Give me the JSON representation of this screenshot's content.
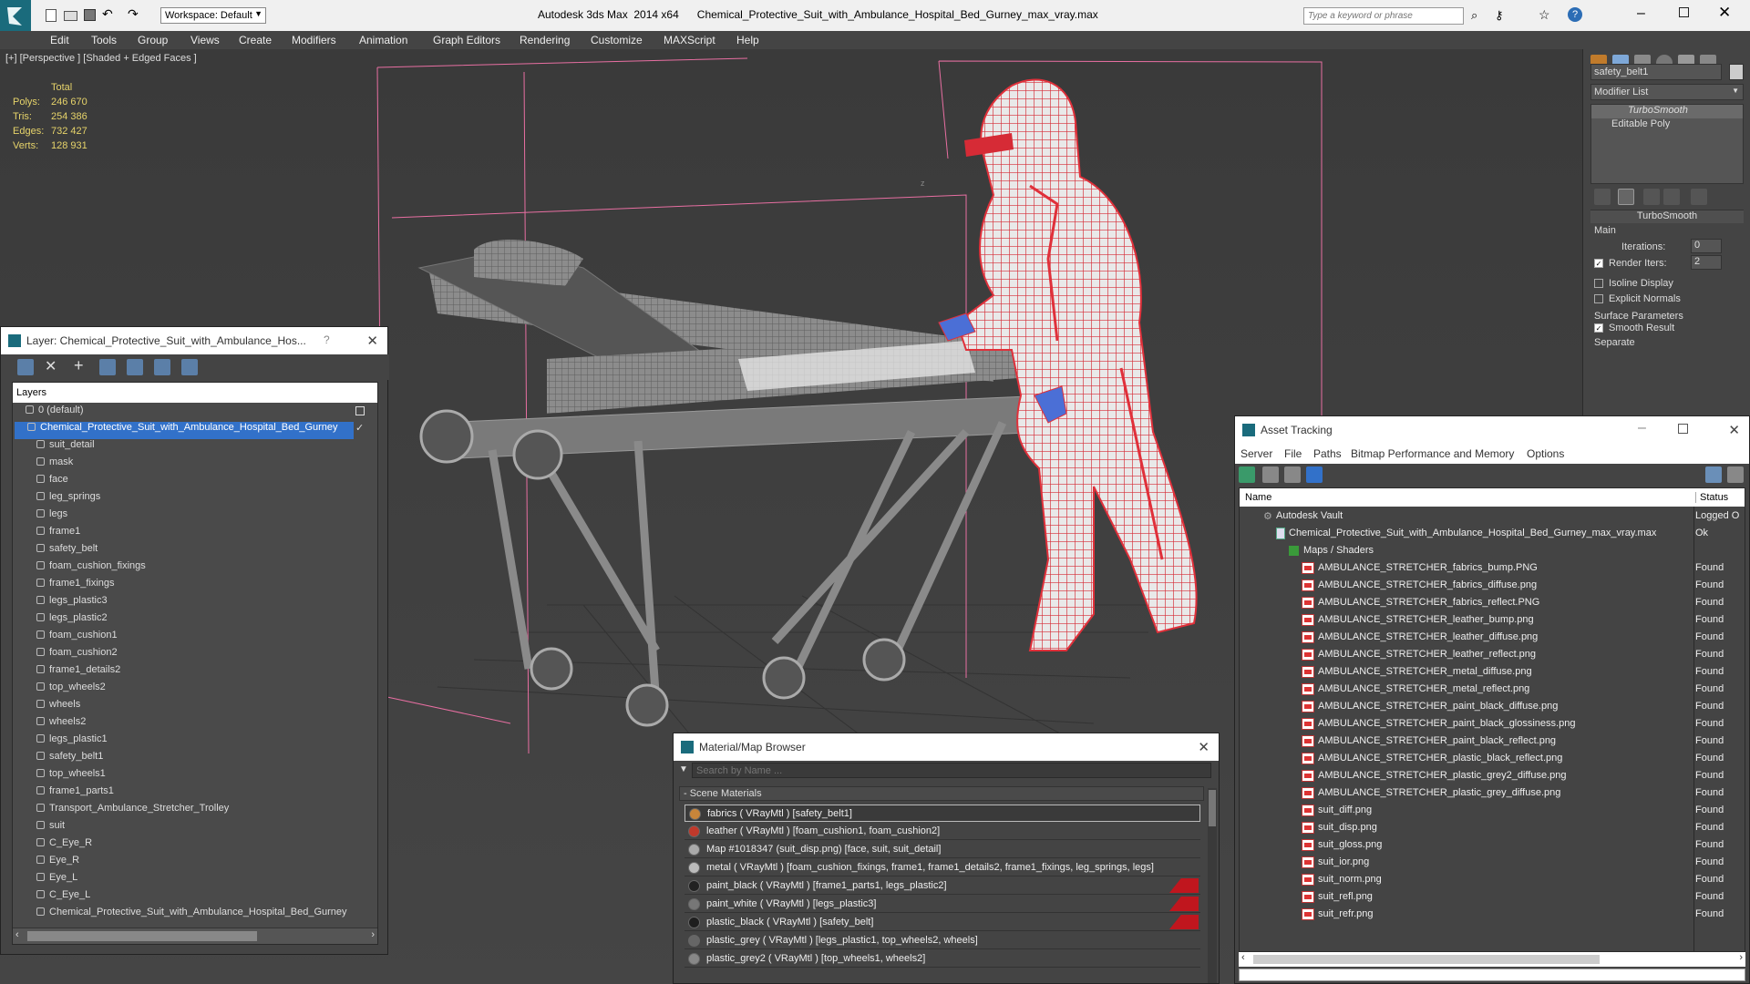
{
  "titlebar": {
    "app_title": "Autodesk 3ds Max  2014 x64",
    "file_title": "Chemical_Protective_Suit_with_Ambulance_Hospital_Bed_Gurney_max_vray.max",
    "workspace": "Workspace: Default",
    "search_placeholder": "Type a keyword or phrase"
  },
  "menu": [
    "Edit",
    "Tools",
    "Group",
    "Views",
    "Create",
    "Modifiers",
    "Animation",
    "Graph Editors",
    "Rendering",
    "Customize",
    "MAXScript",
    "Help"
  ],
  "viewport": {
    "label": "[+] [Perspective ] [Shaded + Edged Faces ]",
    "stats": {
      "total_label": "Total",
      "polys_label": "Polys:",
      "polys": "246 670",
      "tris_label": "Tris:",
      "tris": "254 386",
      "edges_label": "Edges:",
      "edges": "732 427",
      "verts_label": "Verts:",
      "verts": "128 931"
    },
    "axis_z": "z"
  },
  "command_panel": {
    "object_name": "safety_belt1",
    "modifier_list": "Modifier List",
    "stack": [
      "TurboSmooth",
      "Editable Poly"
    ],
    "rollout_title": "TurboSmooth",
    "main_label": "Main",
    "iterations_label": "Iterations:",
    "iterations": "0",
    "render_iters_label": "Render Iters:",
    "render_iters": "2",
    "isoline": "Isoline Display",
    "explicit_normals": "Explicit Normals",
    "surface_params": "Surface Parameters",
    "smooth_result": "Smooth Result",
    "separate": "Separate"
  },
  "layer_panel": {
    "title": "Layer: Chemical_Protective_Suit_with_Ambulance_Hos...",
    "help": "?",
    "header": "Layers",
    "default_layer": "0 (default)",
    "selected_layer": "Chemical_Protective_Suit_with_Ambulance_Hospital_Bed_Gurney",
    "objects": [
      "suit_detail",
      "mask",
      "face",
      "leg_springs",
      "legs",
      "frame1",
      "safety_belt",
      "foam_cushion_fixings",
      "frame1_fixings",
      "legs_plastic3",
      "legs_plastic2",
      "foam_cushion1",
      "foam_cushion2",
      "frame1_details2",
      "top_wheels2",
      "wheels",
      "wheels2",
      "legs_plastic1",
      "safety_belt1",
      "top_wheels1",
      "frame1_parts1",
      "Transport_Ambulance_Stretcher_Trolley",
      "suit",
      "C_Eye_R",
      "Eye_R",
      "Eye_L",
      "C_Eye_L",
      "Chemical_Protective_Suit_with_Ambulance_Hospital_Bed_Gurney"
    ]
  },
  "asset_tracking": {
    "title": "Asset Tracking",
    "menu": [
      "Server",
      "File",
      "Paths",
      "Bitmap Performance and Memory",
      "Options"
    ],
    "col_name": "Name",
    "col_status": "Status",
    "vault": {
      "name": "Autodesk Vault",
      "status": "Logged O"
    },
    "file": {
      "name": "Chemical_Protective_Suit_with_Ambulance_Hospital_Bed_Gurney_max_vray.max",
      "status": "Ok"
    },
    "maps_folder": "Maps / Shaders",
    "maps": [
      {
        "name": "AMBULANCE_STRETCHER_fabrics_bump.PNG",
        "status": "Found"
      },
      {
        "name": "AMBULANCE_STRETCHER_fabrics_diffuse.png",
        "status": "Found"
      },
      {
        "name": "AMBULANCE_STRETCHER_fabrics_reflect.PNG",
        "status": "Found"
      },
      {
        "name": "AMBULANCE_STRETCHER_leather_bump.png",
        "status": "Found"
      },
      {
        "name": "AMBULANCE_STRETCHER_leather_diffuse.png",
        "status": "Found"
      },
      {
        "name": "AMBULANCE_STRETCHER_leather_reflect.png",
        "status": "Found"
      },
      {
        "name": "AMBULANCE_STRETCHER_metal_diffuse.png",
        "status": "Found"
      },
      {
        "name": "AMBULANCE_STRETCHER_metal_reflect.png",
        "status": "Found"
      },
      {
        "name": "AMBULANCE_STRETCHER_paint_black_diffuse.png",
        "status": "Found"
      },
      {
        "name": "AMBULANCE_STRETCHER_paint_black_glossiness.png",
        "status": "Found"
      },
      {
        "name": "AMBULANCE_STRETCHER_paint_black_reflect.png",
        "status": "Found"
      },
      {
        "name": "AMBULANCE_STRETCHER_plastic_black_reflect.png",
        "status": "Found"
      },
      {
        "name": "AMBULANCE_STRETCHER_plastic_grey2_diffuse.png",
        "status": "Found"
      },
      {
        "name": "AMBULANCE_STRETCHER_plastic_grey_diffuse.png",
        "status": "Found"
      },
      {
        "name": "suit_diff.png",
        "status": "Found"
      },
      {
        "name": "suit_disp.png",
        "status": "Found"
      },
      {
        "name": "suit_gloss.png",
        "status": "Found"
      },
      {
        "name": "suit_ior.png",
        "status": "Found"
      },
      {
        "name": "suit_norm.png",
        "status": "Found"
      },
      {
        "name": "suit_refl.png",
        "status": "Found"
      },
      {
        "name": "suit_refr.png",
        "status": "Found"
      }
    ]
  },
  "material_browser": {
    "title": "Material/Map Browser",
    "search_placeholder": "Search by Name ...",
    "group": "- Scene Materials",
    "materials": [
      {
        "label": "fabrics  ( VRayMtl ) [safety_belt1]",
        "swatch": "#c8853a"
      },
      {
        "label": "leather  ( VRayMtl ) [foam_cushion1, foam_cushion2]",
        "swatch": "#c0392b"
      },
      {
        "label": "Map #1018347 (suit_disp.png) [face, suit, suit_detail]",
        "swatch": "#aaaaaa"
      },
      {
        "label": "metal  ( VRayMtl ) [foam_cushion_fixings, frame1, frame1_details2, frame1_fixings, leg_springs, legs]",
        "swatch": "#bbbbbb"
      },
      {
        "label": "paint_black  ( VRayMtl ) [frame1_parts1, legs_plastic2]",
        "swatch": "#222222"
      },
      {
        "label": "paint_white  ( VRayMtl ) [legs_plastic3]",
        "swatch": "#777777"
      },
      {
        "label": "plastic_black  ( VRayMtl ) [safety_belt]",
        "swatch": "#1e1e1e"
      },
      {
        "label": "plastic_grey  ( VRayMtl ) [legs_plastic1, top_wheels2, wheels]",
        "swatch": "#666666"
      },
      {
        "label": "plastic_grey2  ( VRayMtl ) [top_wheels1, wheels2]",
        "swatch": "#888888"
      }
    ]
  },
  "colors": {
    "selection_blue": "#3271c9",
    "wire_red": "#e0303a",
    "bbox_pink": "#e86fa2",
    "stats_yellow": "#e6d36a"
  }
}
